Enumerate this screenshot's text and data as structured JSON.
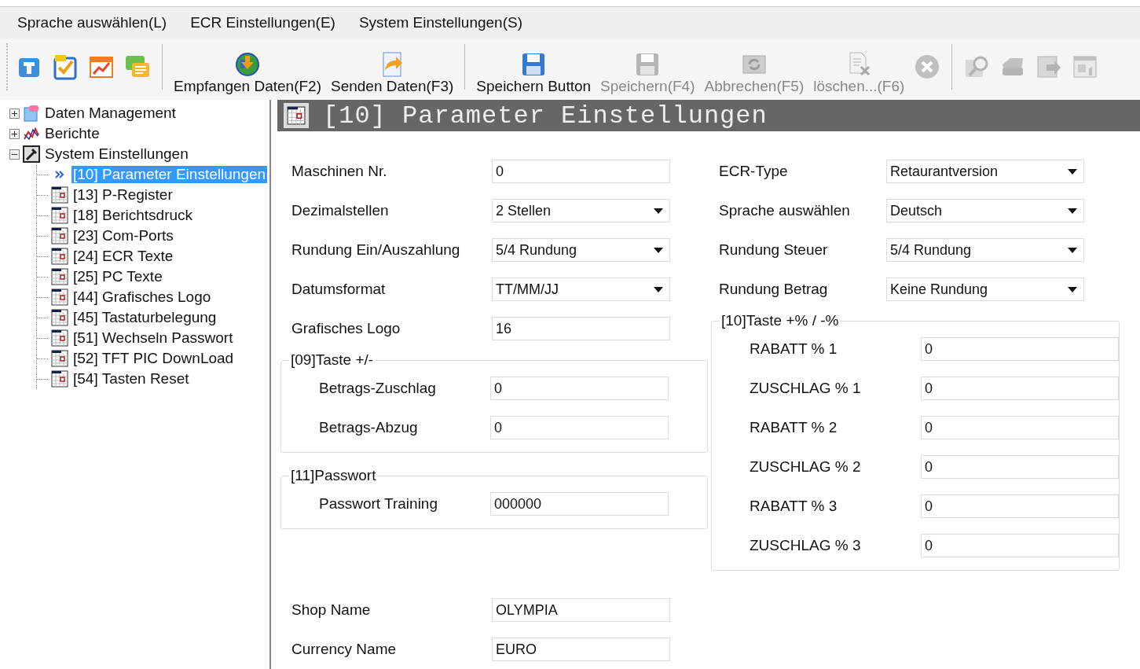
{
  "menu": [
    {
      "label": "Sprache auswählen(L)"
    },
    {
      "label": "ECR Einstellungen(E)"
    },
    {
      "label": "System Einstellungen(S)"
    }
  ],
  "toolbar": [
    {
      "kind": "icon",
      "disabled": false
    },
    {
      "kind": "icon",
      "disabled": false
    },
    {
      "kind": "icon",
      "disabled": false
    },
    {
      "kind": "icon",
      "disabled": false
    },
    {
      "kind": "separator"
    },
    {
      "kind": "labeled",
      "label": "Empfangen Daten(F2)",
      "disabled": false
    },
    {
      "kind": "labeled",
      "label": "Senden Daten(F3)",
      "disabled": false
    },
    {
      "kind": "separator"
    },
    {
      "kind": "labeled",
      "label": "Speichern Button",
      "disabled": false
    },
    {
      "kind": "labeled",
      "label": "Speichern(F4)",
      "disabled": true
    },
    {
      "kind": "labeled",
      "label": "Abbrechen(F5)",
      "disabled": true
    },
    {
      "kind": "labeled",
      "label": "löschen...(F6)",
      "disabled": true
    },
    {
      "kind": "icon",
      "disabled": true
    },
    {
      "kind": "separator"
    },
    {
      "kind": "icon",
      "disabled": true
    },
    {
      "kind": "icon",
      "disabled": true
    },
    {
      "kind": "icon",
      "disabled": true
    },
    {
      "kind": "icon",
      "disabled": true
    }
  ],
  "tree": [
    {
      "label": "Daten Management",
      "expanded": false,
      "selected": false
    },
    {
      "label": "Berichte",
      "expanded": false,
      "selected": false
    },
    {
      "label": "System Einstellungen",
      "expanded": true,
      "selected": false,
      "children": [
        {
          "label": "[10] Parameter Einstellungen",
          "selected": true
        },
        {
          "label": "[13] P-Register",
          "selected": false
        },
        {
          "label": "[18] Berichtsdruck",
          "selected": false
        },
        {
          "label": "[23] Com-Ports",
          "selected": false
        },
        {
          "label": "[24] ECR Texte",
          "selected": false
        },
        {
          "label": "[25] PC Texte",
          "selected": false
        },
        {
          "label": "[44] Grafisches Logo",
          "selected": false
        },
        {
          "label": "[45] Tastaturbelegung",
          "selected": false
        },
        {
          "label": "[51] Wechseln Passwort",
          "selected": false
        },
        {
          "label": "[52] TFT PIC DownLoad",
          "selected": false
        },
        {
          "label": "[54] Tasten Reset",
          "selected": false
        }
      ]
    }
  ],
  "panel": {
    "title": "[10] Parameter Einstellungen",
    "left_fields": [
      {
        "label": "Maschinen Nr.",
        "kind": "text",
        "value": "0"
      },
      {
        "label": "Dezimalstellen",
        "kind": "select",
        "value": "2 Stellen"
      },
      {
        "label": "Rundung Ein/Auszahlung",
        "kind": "select",
        "value": "5/4 Rundung"
      },
      {
        "label": "Datumsformat",
        "kind": "select",
        "value": "TT/MM/JJ"
      },
      {
        "label": "Grafisches Logo",
        "kind": "text",
        "value": "16"
      }
    ],
    "groups": [
      {
        "title": "[09]Taste +/-",
        "fields": [
          {
            "label": "Betrags-Zuschlag",
            "kind": "text",
            "value": "0"
          },
          {
            "label": "Betrags-Abzug",
            "kind": "text",
            "value": "0"
          }
        ]
      },
      {
        "title": "[11]Passwort",
        "fields": [
          {
            "label": "Passwort Training",
            "kind": "text",
            "value": "000000"
          }
        ]
      }
    ],
    "bottom_fields": [
      {
        "label": "Shop Name",
        "kind": "text",
        "value": "OLYMPIA"
      },
      {
        "label": "Currency Name",
        "kind": "text",
        "value": "EURO"
      }
    ],
    "right_fields": [
      {
        "label": "ECR-Type",
        "kind": "select",
        "value": "Retaurantversion"
      },
      {
        "label": "Sprache auswählen",
        "kind": "select",
        "value": "Deutsch"
      },
      {
        "label": "Rundung Steuer",
        "kind": "select",
        "value": "5/4 Rundung"
      },
      {
        "label": "Rundung Betrag",
        "kind": "select",
        "value": "Keine Rundung"
      }
    ],
    "right_group": {
      "title": "[10]Taste +% / -%",
      "fields": [
        {
          "label": "RABATT % 1",
          "kind": "text",
          "value": "0"
        },
        {
          "label": "ZUSCHLAG % 1",
          "kind": "text",
          "value": "0"
        },
        {
          "label": "RABATT % 2",
          "kind": "text",
          "value": "0"
        },
        {
          "label": "ZUSCHLAG % 2",
          "kind": "text",
          "value": "0"
        },
        {
          "label": "RABATT % 3",
          "kind": "text",
          "value": "0"
        },
        {
          "label": "ZUSCHLAG % 3",
          "kind": "text",
          "value": "0"
        }
      ]
    }
  }
}
